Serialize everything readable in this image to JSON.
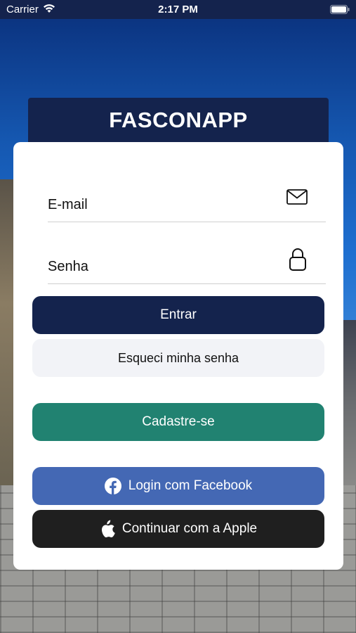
{
  "status_bar": {
    "carrier": "Carrier",
    "time": "2:17 PM",
    "wifi_icon": "wifi-icon",
    "battery_icon": "battery-icon"
  },
  "header": {
    "title": "FASCONAPP"
  },
  "form": {
    "email": {
      "placeholder": "E-mail",
      "value": "",
      "icon": "envelope-icon"
    },
    "password": {
      "placeholder": "Senha",
      "value": "",
      "icon": "lock-icon"
    }
  },
  "buttons": {
    "login": "Entrar",
    "forgot": "Esqueci minha senha",
    "register": "Cadastre-se",
    "facebook": "Login com Facebook",
    "apple": "Continuar com a Apple"
  },
  "colors": {
    "brand_dark": "#14234d",
    "register_green": "#218271",
    "facebook_blue": "#4468b4",
    "apple_black": "#1f1f1f"
  }
}
